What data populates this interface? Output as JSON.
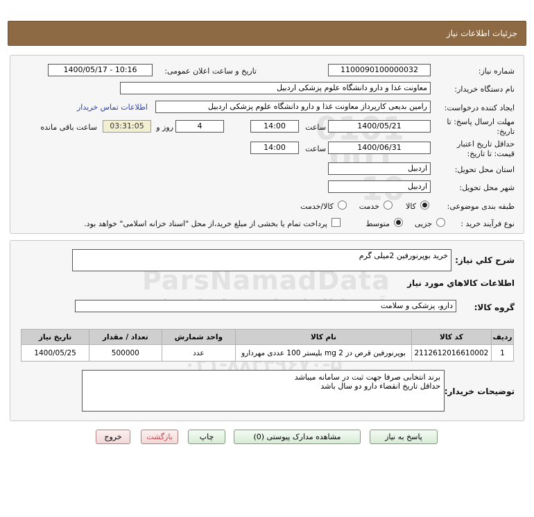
{
  "header": {
    "title": "جزئیات اطلاعات نیاز"
  },
  "form": {
    "need_number_label": "شماره نیاز:",
    "need_number": "1100090100000032",
    "announce_label": "تاریخ و ساعت اعلان عمومی:",
    "announce_value": "1400/05/17 - 10:16",
    "buyer_org_label": "نام دستگاه خریدار:",
    "buyer_org": "معاونت غذا و دارو دانشگاه علوم پزشکی اردبیل",
    "creator_label": "ایجاد کننده درخواست:",
    "creator": "رامین  بدیعی  کارپرداز  معاونت غذا و دارو دانشگاه علوم پزشکی اردبیل",
    "contact_link": "اطلاعات تماس خریدار",
    "reply_deadline_label_1": "مهلت ارسال پاسخ: تا",
    "reply_deadline_label_2": "تاریخ:",
    "reply_date": "1400/05/21",
    "time_label": "ساعت",
    "reply_time": "14:00",
    "days_value": "4",
    "days_label": "روز و",
    "remaining_time": "03:31:05",
    "remaining_label": "ساعت باقی مانده",
    "validity_label_1": "حداقل تاریخ اعتبار",
    "validity_label_2": "قیمت: تا تاریخ:",
    "validity_date": "1400/06/31",
    "validity_time_label": "ساعت",
    "validity_time": "14:00",
    "province_label": "استان محل تحویل:",
    "province": "اردبیل",
    "city_label": "شهر محل تحویل:",
    "city": "اردبیل",
    "category_label": "طبقه بندی موضوعی:",
    "category_options": [
      "کالا",
      "خدمت",
      "کالا/خدمت"
    ],
    "category_selected": "کالا",
    "process_label": "نوع فرآیند خرید :",
    "process_options": [
      "جزیی",
      "متوسط"
    ],
    "process_selected": "متوسط",
    "payment_note": "پرداخت تمام یا بخشی از مبلغ خرید،از محل \"اسناد خزانه اسلامی\" خواهد بود."
  },
  "summary": {
    "label": "شرح كلي نياز:",
    "value": "خرید بوپرنورفین 2میلی گرم"
  },
  "goods": {
    "section_title": "اطلاعات كالاهاي مورد نياز",
    "group_label": "گروه کالا:",
    "group_value": "دارو، پزشکی و سلامت",
    "columns": [
      "ردیف",
      "کد کالا",
      "نام کالا",
      "واحد شمارش",
      "تعداد / مقدار",
      "تاریخ نیاز"
    ],
    "rows": [
      [
        "1",
        "2112612016610002",
        "بوپرنورفین قرص دز 2 mg بلیستر 100 عددی مهردارو",
        "عدد",
        "500000",
        "1400/05/25"
      ]
    ]
  },
  "buyer_notes": {
    "label": "توضیحات خریدار:",
    "line1": "برند انتخابی صرفا جهت ثبت در سامانه میباشد",
    "line2": "حداقل تاریخ انقضاء دارو دو سال باشد"
  },
  "buttons": {
    "reply": "پاسخ به نیاز",
    "attachments": "مشاهده مدارک پیوستی (0)",
    "print": "چاپ",
    "back": "بازگشت",
    "exit": "خروج"
  },
  "watermark": {
    "brand": "ParsNamadData",
    "line_fa_1": "پایگاه اطلاع رسانی مناقصات و مزایده",
    "line_fa_2": "فن آوری اطلاعات پارس نماد داده ها",
    "phone": "۰۲۱-۸۸۳۴۹۶۷۰-۵",
    "code_1": "0101",
    "code_2": "001",
    "code_3": "10"
  },
  "colors": {
    "header_bg": "#8e6a44",
    "panel_bg": "#f6f6f6",
    "link": "#2a3fb0",
    "timer_bg": "#f3f0d2"
  }
}
